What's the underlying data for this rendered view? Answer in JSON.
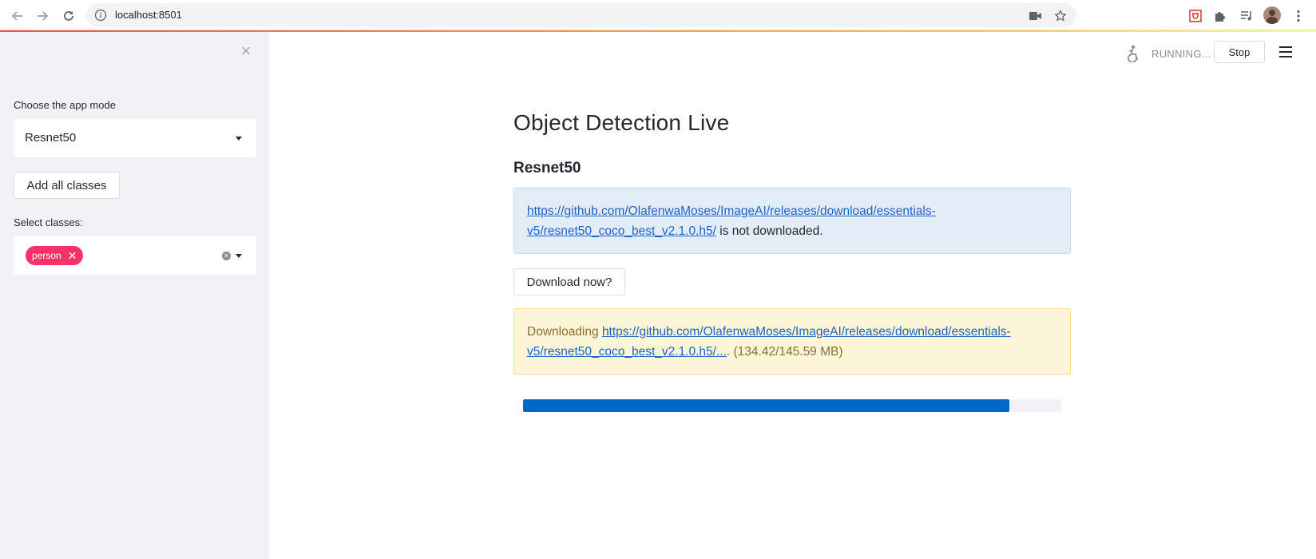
{
  "browser": {
    "url": "localhost:8501"
  },
  "sidebar": {
    "app_mode_label": "Choose the app mode",
    "app_mode_value": "Resnet50",
    "add_all_label": "Add all classes",
    "classes_label": "Select classes:",
    "selected_classes": [
      "person"
    ]
  },
  "toolbar": {
    "status": "RUNNING...",
    "stop_label": "Stop"
  },
  "main": {
    "title": "Object Detection Live",
    "subheader": "Resnet50",
    "info_link_line1": "https://github.com/OlafenwaMoses/ImageAI/releases/download/essentials-",
    "info_link_line2": "v5/resnet50_coco_best_v2.1.0.h5/",
    "info_suffix": " is not downloaded.",
    "download_button": "Download now?",
    "warn_prefix": "Downloading ",
    "warn_link_line1": "https://github.com/OlafenwaMoses/ImageAI/releases/download/essentials-",
    "warn_link_line2": "v5/resnet50_coco_best_v2.1.0.h5/...",
    "warn_suffix": ". (134.42/145.59 MB)",
    "progress_fraction": 0.9035
  },
  "colors": {
    "primary": "#f63366",
    "progress": "#0068c9",
    "sidebar_bg": "#f0f2f6",
    "info_bg": "#e3edf8",
    "warning_bg": "#fdf5d7"
  },
  "icons": [
    "back-icon",
    "forward-icon",
    "reload-icon",
    "info-icon",
    "camera-icon",
    "star-icon",
    "extension-icon",
    "puzzle-icon",
    "media-icon",
    "menu-dots-icon",
    "close-icon",
    "running-man-icon",
    "hamburger-icon"
  ]
}
